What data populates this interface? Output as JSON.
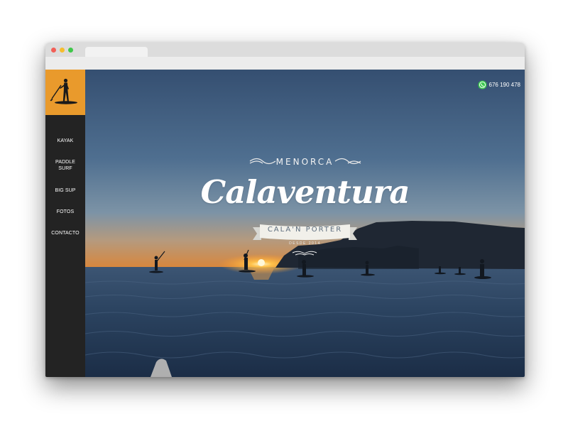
{
  "browser": {
    "window_controls": [
      "close",
      "minimize",
      "zoom"
    ]
  },
  "sidebar": {
    "logo": "paddle-surfer-logo",
    "items": [
      {
        "label": "KAYAK"
      },
      {
        "label": "PADDLE SURF"
      },
      {
        "label": "BIG SUP"
      },
      {
        "label": "FOTOS"
      },
      {
        "label": "CONTACTO"
      }
    ]
  },
  "header": {
    "phone": "676 190 478",
    "phone_icon": "whatsapp-icon"
  },
  "hero": {
    "kicker": "MENORCA",
    "brand": "Calaventura",
    "ribbon": "CALA'N PORTER",
    "since": "DESDE 2014"
  },
  "colors": {
    "accent": "#e99a2c",
    "sidebar": "#232323",
    "sky_top": "#3a5577",
    "sea": "#243955"
  }
}
